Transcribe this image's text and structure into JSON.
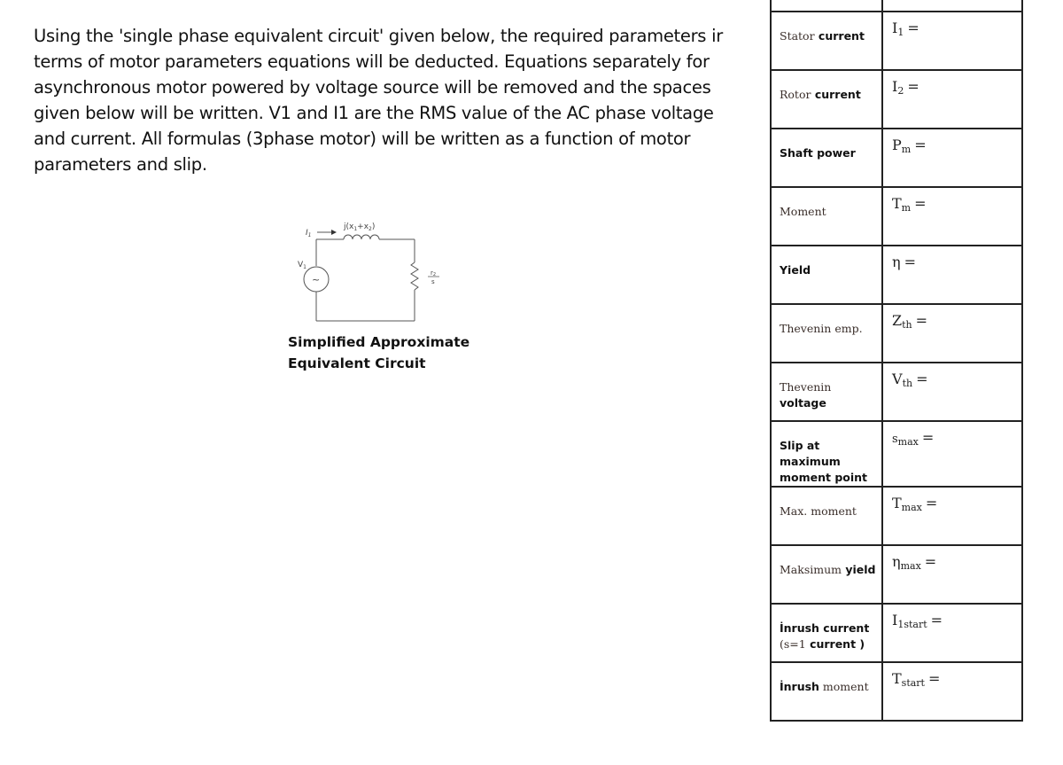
{
  "intro": {
    "lines": [
      "Using the 'single phase equivalent circuit' given below, the required parameters ir",
      "terms of motor parameters equations will be deducted. Equations separately for",
      "asynchronous motor powered by voltage source will be removed and the spaces",
      "given below will be written. V1 and I1 are the RMS value of the AC phase voltage",
      "and current. All formulas  (3phase motor) will be written as a function of motor",
      "parameters and slip."
    ]
  },
  "circuit": {
    "current_label": "I",
    "current_sub": "1",
    "reactance_label": "j(x",
    "reactance_sub1": "1",
    "reactance_plus": "+x",
    "reactance_sub2": "2",
    "reactance_close": ")",
    "voltage_label": "V",
    "voltage_sub": "1",
    "source_symbol": "~",
    "resistor_num": "r",
    "resistor_num_sub": "2",
    "resistor_den": "s",
    "caption_line1": "Simplified Approximate",
    "caption_line2": "Equivalent Circuit"
  },
  "table": {
    "rows": [
      {
        "label_parts": [
          {
            "t": "Stator",
            "style": "serif"
          },
          {
            "t": " current",
            "style": "sans"
          }
        ],
        "symbol": "I",
        "sub": "1",
        "eq": "="
      },
      {
        "label_parts": [
          {
            "t": "Rotor",
            "style": "serif"
          },
          {
            "t": " current",
            "style": "sans"
          }
        ],
        "symbol": "I",
        "sub": "2",
        "eq": "="
      },
      {
        "label_parts": [
          {
            "t": "Shaft power",
            "style": "sans"
          }
        ],
        "symbol": "P",
        "sub": "m",
        "eq": "="
      },
      {
        "label_parts": [
          {
            "t": "Moment",
            "style": "serif"
          }
        ],
        "symbol": "T",
        "sub": "m",
        "eq": "="
      },
      {
        "label_parts": [
          {
            "t": "Yield",
            "style": "sans"
          }
        ],
        "symbol": "η",
        "sub": "",
        "eq": "="
      },
      {
        "label_parts": [
          {
            "t": "Thevenin emp.",
            "style": "serif"
          }
        ],
        "symbol": "Z",
        "sub": "th",
        "eq": "="
      },
      {
        "label_parts": [
          {
            "t": "Thevenin",
            "style": "serif"
          },
          {
            "t": " voltage",
            "style": "sans"
          }
        ],
        "symbol": "V",
        "sub": "th",
        "eq": "="
      },
      {
        "label_parts": [
          {
            "t": "Slip at maximum moment point",
            "style": "sans"
          }
        ],
        "symbol": "s",
        "sub": "max",
        "eq": "="
      },
      {
        "label_parts": [
          {
            "t": "Max. moment",
            "style": "serif"
          }
        ],
        "symbol": "T",
        "sub": "max",
        "eq": "="
      },
      {
        "label_parts": [
          {
            "t": "Maksimum",
            "style": "serif"
          },
          {
            "t": " yield",
            "style": "sans"
          }
        ],
        "symbol": "η",
        "sub": "max",
        "eq": "="
      },
      {
        "label_parts": [
          {
            "t": "İnrush current",
            "style": "sans"
          },
          {
            "t": "(s=1",
            "style": "serif"
          },
          {
            "t": " current )",
            "style": "sans"
          }
        ],
        "symbol": "I",
        "sub": "1start",
        "eq": "="
      },
      {
        "label_parts": [
          {
            "t": "İnrush",
            "style": "sans"
          },
          {
            "t": " moment",
            "style": "serif"
          }
        ],
        "symbol": "T",
        "sub": "start",
        "eq": "="
      }
    ]
  }
}
